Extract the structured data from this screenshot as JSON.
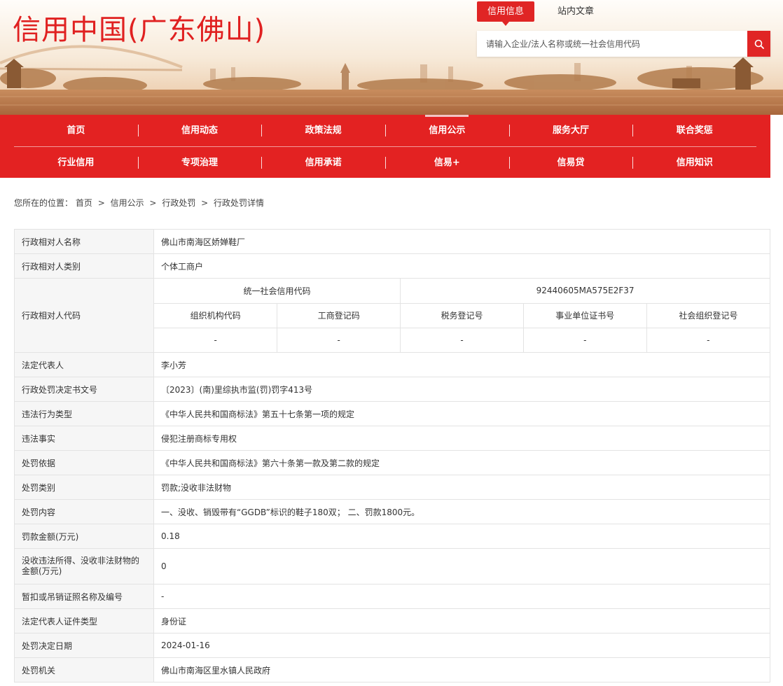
{
  "header": {
    "site_title": "信用中国(广东佛山)",
    "search_tabs": [
      {
        "label": "信用信息",
        "active": true
      },
      {
        "label": "站内文章",
        "active": false
      }
    ],
    "search_placeholder": "请输入企业/法人名称或统一社会信用代码",
    "search_icon": "search-icon"
  },
  "nav": {
    "row1": [
      "首页",
      "信用动态",
      "政策法规",
      "信用公示",
      "服务大厅",
      "联合奖惩"
    ],
    "row2": [
      "行业信用",
      "专项治理",
      "信用承诺",
      "信易+",
      "信易贷",
      "信用知识"
    ],
    "active": "信用公示"
  },
  "breadcrumb": {
    "prefix": "您所在的位置：",
    "items": [
      "首页",
      "信用公示",
      "行政处罚",
      "行政处罚详情"
    ],
    "separator": ">"
  },
  "detail": {
    "name_label": "行政相对人名称",
    "name_value": "佛山市南海区娇婵鞋厂",
    "category_label": "行政相对人类别",
    "category_value": "个体工商户",
    "code_label": "行政相对人代码",
    "usci_label": "统一社会信用代码",
    "usci_value": "92440605MA575E2F37",
    "sub_headers": [
      "组织机构代码",
      "工商登记码",
      "税务登记号",
      "事业单位证书号",
      "社会组织登记号"
    ],
    "sub_values": [
      "-",
      "-",
      "-",
      "-",
      "-"
    ],
    "rows": [
      {
        "label": "法定代表人",
        "value": "李小芳"
      },
      {
        "label": "行政处罚决定书文号",
        "value": "〔2023〕(南)里综执市监(罚)罚字413号"
      },
      {
        "label": "违法行为类型",
        "value": "《中华人民共和国商标法》第五十七条第一项的规定"
      },
      {
        "label": "违法事实",
        "value": "侵犯注册商标专用权"
      },
      {
        "label": "处罚依据",
        "value": "《中华人民共和国商标法》第六十条第一款及第二款的规定"
      },
      {
        "label": "处罚类别",
        "value": "罚款;没收非法财物"
      },
      {
        "label": "处罚内容",
        "value": "一、没收、销毁带有“GGDB”标识的鞋子180双； 二、罚款1800元。"
      },
      {
        "label": "罚款金额(万元)",
        "value": "0.18"
      }
    ],
    "confiscation_label": "没收违法所得、没收非法财物的金额(万元)",
    "confiscation_value": "0",
    "rows2": [
      {
        "label": "暂扣或吊销证照名称及编号",
        "value": "-"
      },
      {
        "label": "法定代表人证件类型",
        "value": "身份证"
      },
      {
        "label": "处罚决定日期",
        "value": "2024-01-16"
      },
      {
        "label": "处罚机关",
        "value": "佛山市南海区里水镇人民政府"
      }
    ]
  },
  "colors": {
    "brand_red": "#e32222",
    "label_bg": "#f6f6f6",
    "border": "#e3e3e3"
  }
}
